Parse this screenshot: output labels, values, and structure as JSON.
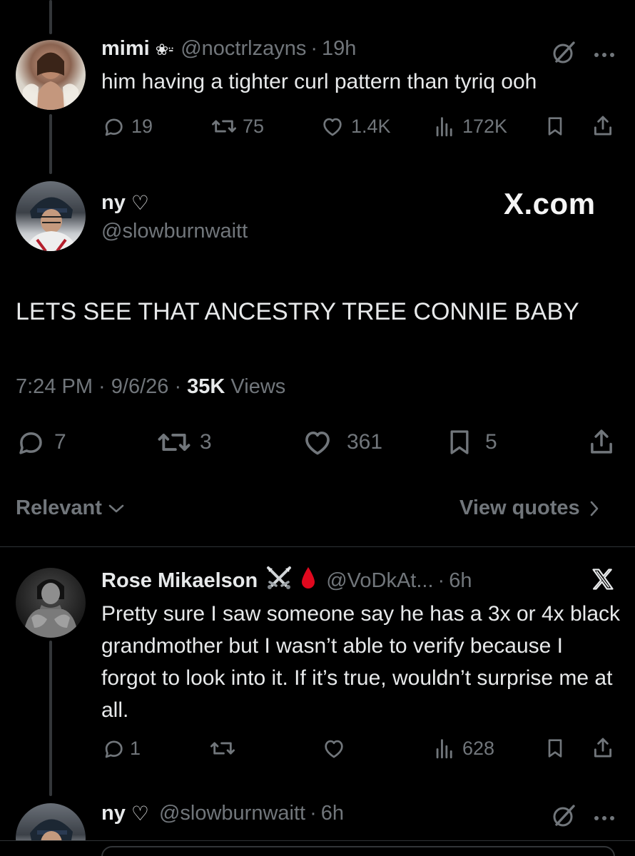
{
  "tweet1": {
    "name": "mimi",
    "name_emoji": "❀⸚",
    "handle": "@noctrlzayns",
    "sep": "·",
    "time": "19h",
    "text": "him having a tighter curl pattern than tyriq ooh",
    "replies": "19",
    "reposts": "75",
    "likes": "1.4K",
    "views": "172K"
  },
  "main": {
    "name": "ny",
    "name_heart": "♡",
    "handle": "@slowburnwaitt",
    "watermark": "X.com",
    "text": "LETS SEE THAT ANCESTRY TREE CONNIE BABY",
    "timestamp": "7:24 PM · 9/6/26 · ",
    "views_count": "35K",
    "views_label": " Views",
    "replies": "7",
    "reposts": "3",
    "likes": "361",
    "bookmarks": "5"
  },
  "sort": {
    "relevant": "Relevant",
    "view_quotes": "View quotes"
  },
  "reply1": {
    "name": "Rose Mikaelson",
    "handle": "@VoDkAt...",
    "sep": "·",
    "time": "6h",
    "text": "Pretty sure I saw someone say he has a 3x or 4x black grandmother but I wasn’t able to verify because I forgot to look into it. If it’s true, wouldn’t surprise me at all.",
    "replies": "1",
    "views": "628"
  },
  "reply2": {
    "name": "ny",
    "name_heart": "♡",
    "handle": "@slowburnwaitt",
    "sep": "·",
    "time": "6h"
  },
  "colors": {
    "background": "#000000",
    "text": "#e7e9ea",
    "muted": "#71767b",
    "divider": "#2f3336",
    "blood": "#e0081e"
  }
}
